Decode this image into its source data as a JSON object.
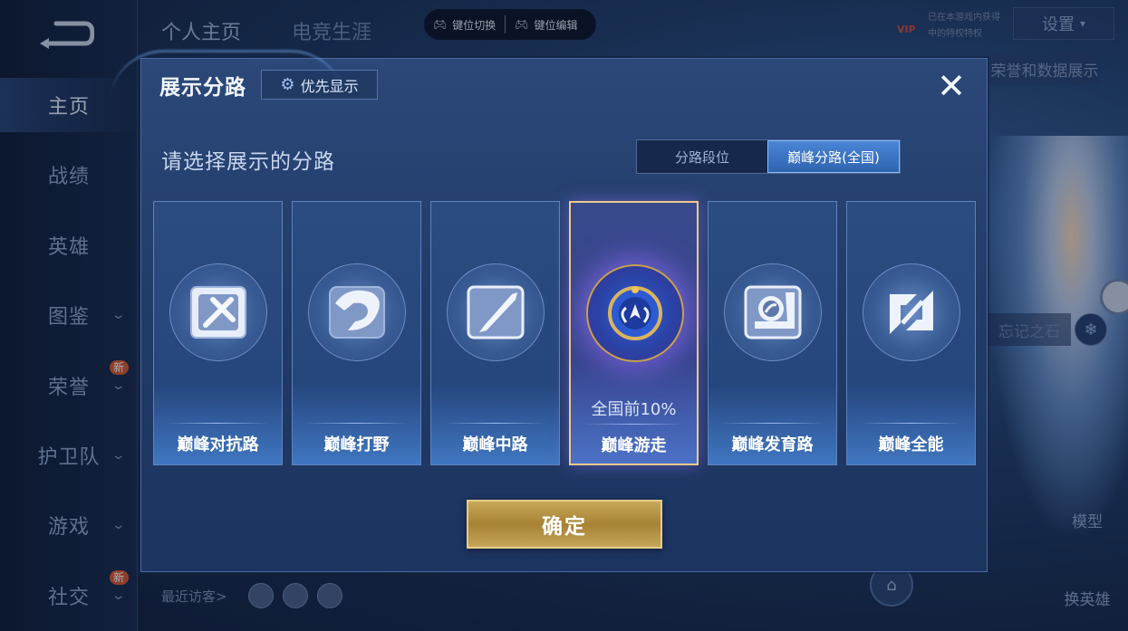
{
  "sidebar": {
    "items": [
      {
        "label": "主页",
        "active": true,
        "chevron": false,
        "badge": ""
      },
      {
        "label": "战绩",
        "active": false,
        "chevron": false,
        "badge": ""
      },
      {
        "label": "英雄",
        "active": false,
        "chevron": false,
        "badge": ""
      },
      {
        "label": "图鉴",
        "active": false,
        "chevron": true,
        "badge": ""
      },
      {
        "label": "荣誉",
        "active": false,
        "chevron": true,
        "badge": "新"
      },
      {
        "label": "护卫队",
        "active": false,
        "chevron": true,
        "badge": ""
      },
      {
        "label": "游戏",
        "active": false,
        "chevron": true,
        "badge": ""
      },
      {
        "label": "社交",
        "active": false,
        "chevron": true,
        "badge": "新"
      }
    ]
  },
  "header": {
    "tabs": [
      "个人主页",
      "电竞生涯"
    ],
    "key_switch": "键位切换",
    "key_edit": "键位编辑",
    "vip_label": "VIP",
    "vip_line1": "已在本游戏内获得",
    "vip_line2": "中的特权特权",
    "settings": "设置"
  },
  "background": {
    "data_show": "荣誉和数据展示",
    "remember_stone": "忘记之石",
    "model_label": "模型",
    "change_hero_label": "换英雄",
    "recent_visitors": "最近访客>"
  },
  "modal": {
    "title": "展示分路",
    "priority_button": "优先显示",
    "close_icon": "close-icon",
    "prompt": "请选择展示的分路",
    "segment": {
      "options": [
        "分路段位",
        "巅峰分路(全国)"
      ],
      "selected": 1
    },
    "cards": [
      {
        "label": "巅峰对抗路",
        "rank": "",
        "selected": false,
        "icon": "sword-cross-icon"
      },
      {
        "label": "巅峰打野",
        "rank": "",
        "selected": false,
        "icon": "dragon-icon"
      },
      {
        "label": "巅峰中路",
        "rank": "",
        "selected": false,
        "icon": "slash-icon"
      },
      {
        "label": "巅峰游走",
        "rank": "全国前10%",
        "selected": true,
        "icon": "winged-emblem-icon"
      },
      {
        "label": "巅峰发育路",
        "rank": "",
        "selected": false,
        "icon": "target-icon"
      },
      {
        "label": "巅峰全能",
        "rank": "",
        "selected": false,
        "icon": "all-round-icon"
      }
    ],
    "confirm_button": "确定"
  },
  "colors": {
    "accent_gold": "#e7cd86",
    "segment_active": "#3f76c6",
    "panel": "#24406f"
  }
}
